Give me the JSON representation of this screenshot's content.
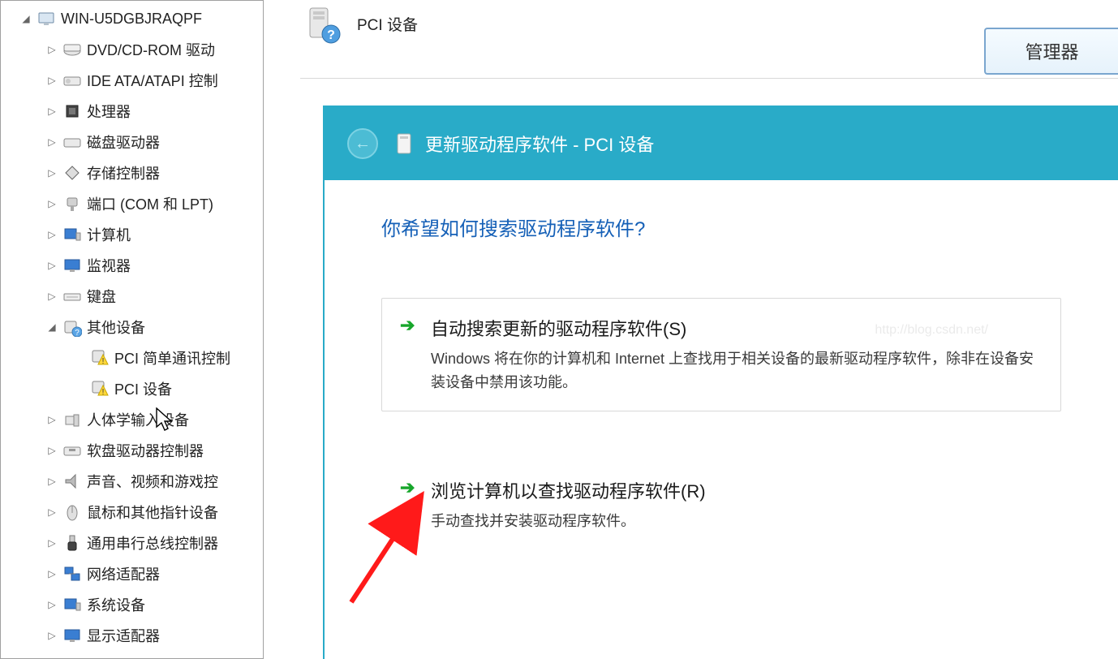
{
  "mgr_tab_label": "管理器",
  "header": {
    "title": "PCI 设备"
  },
  "tree": {
    "root": "WIN-U5DGBJRAQPF",
    "items": [
      {
        "label": "DVD/CD-ROM 驱动",
        "icon": "disc"
      },
      {
        "label": "IDE ATA/ATAPI 控制",
        "icon": "ide"
      },
      {
        "label": "处理器",
        "icon": "cpu"
      },
      {
        "label": "磁盘驱动器",
        "icon": "disk"
      },
      {
        "label": "存储控制器",
        "icon": "storage"
      },
      {
        "label": "端口 (COM 和 LPT)",
        "icon": "port"
      },
      {
        "label": "计算机",
        "icon": "computer"
      },
      {
        "label": "监视器",
        "icon": "monitor"
      },
      {
        "label": "键盘",
        "icon": "keyboard"
      },
      {
        "label": "其他设备",
        "icon": "other",
        "expanded": true,
        "children": [
          {
            "label": "PCI 简单通讯控制",
            "icon": "warn"
          },
          {
            "label": "PCI 设备",
            "icon": "warn"
          }
        ]
      },
      {
        "label": "人体学输入设备",
        "icon": "hid"
      },
      {
        "label": "软盘驱动器控制器",
        "icon": "floppy"
      },
      {
        "label": "声音、视频和游戏控",
        "icon": "sound"
      },
      {
        "label": "鼠标和其他指针设备",
        "icon": "mouse"
      },
      {
        "label": "通用串行总线控制器",
        "icon": "usb"
      },
      {
        "label": "网络适配器",
        "icon": "network"
      },
      {
        "label": "系统设备",
        "icon": "system"
      },
      {
        "label": "显示适配器",
        "icon": "display"
      }
    ]
  },
  "dialog": {
    "title": "更新驱动程序软件 - PCI 设备",
    "question": "你希望如何搜索驱动程序软件?",
    "options": [
      {
        "title": "自动搜索更新的驱动程序软件(S)",
        "desc": "Windows 将在你的计算机和 Internet 上查找用于相关设备的最新驱动程序软件，除非在设备安装设备中禁用该功能。"
      },
      {
        "title": "浏览计算机以查找驱动程序软件(R)",
        "desc": "手动查找并安装驱动程序软件。"
      }
    ]
  },
  "watermark": "http://blog.csdn.net/"
}
